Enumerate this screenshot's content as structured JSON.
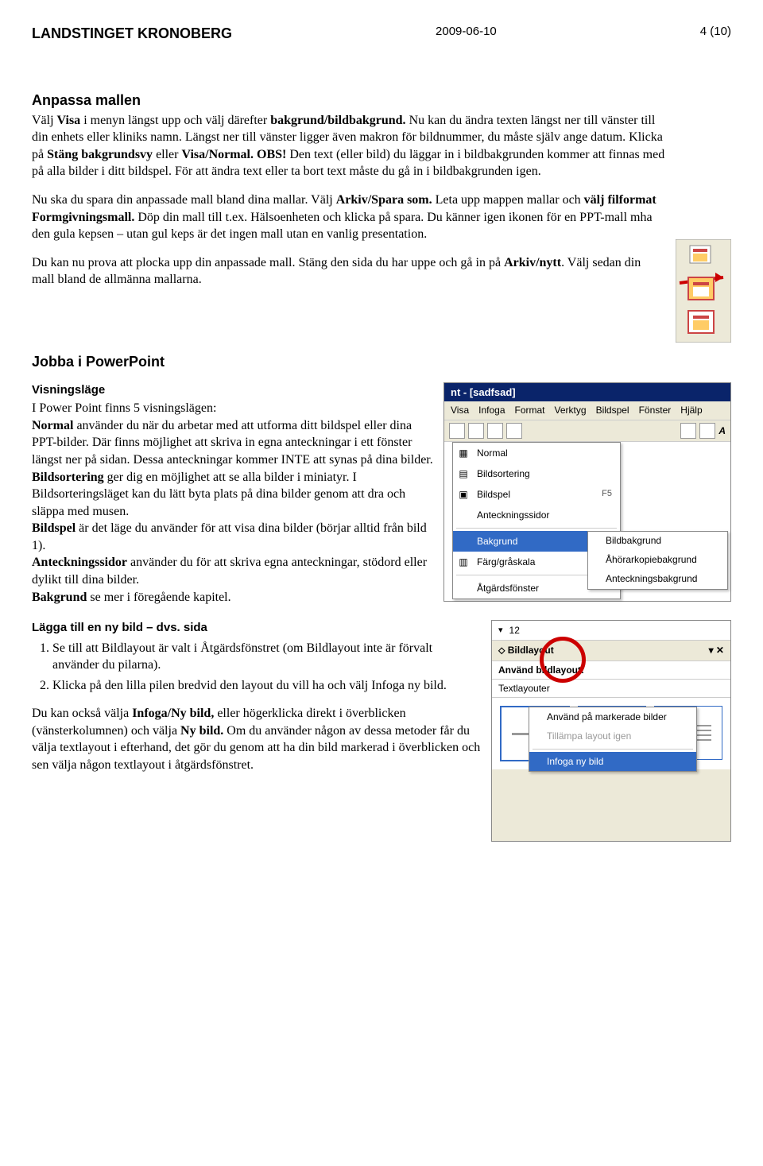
{
  "header": {
    "org": "LANDSTINGET KRONOBERG",
    "date": "2009-06-10",
    "page": "4 (10)"
  },
  "section1": {
    "title": "Anpassa mallen",
    "p1a": "Välj ",
    "p1b": "Visa",
    "p1c": " i menyn längst upp och välj därefter ",
    "p1d": "bakgrund/bildbakgrund.",
    "p1e": " Nu kan du ändra texten längst ner till vänster till din enhets eller kliniks namn. Längst ner till vänster ligger även makron för bildnummer, du måste själv ange datum. Klicka på ",
    "p1f": "Stäng bakgrundsvy",
    "p1g": " eller ",
    "p1h": "Visa/Normal.",
    "p1i": " ",
    "p1j": "OBS!",
    "p1k": " Den text (eller bild) du läggar in i bildbakgrunden kommer att finnas med på alla bilder i ditt bildspel. För att ändra text eller ta bort text måste du gå in i bildbakgrunden igen.",
    "p2a": "Nu ska du spara din anpassade mall bland dina mallar. Välj ",
    "p2b": "Arkiv/Spara som.",
    "p2c": " Leta upp mappen mallar och ",
    "p2d": "välj filformat Formgivningsmall.",
    "p2e": " Döp din mall till t.ex. Hälsoenheten och klicka på spara. Du känner igen ikonen för en PPT-mall mha den gula kepsen – utan gul keps är det ingen mall utan en vanlig presentation.",
    "p3a": "Du kan nu prova att plocka upp din anpassade mall. Stäng den sida du har uppe och gå in på ",
    "p3b": "Arkiv/nytt",
    "p3c": ". Välj sedan din mall bland de allmänna mallarna."
  },
  "section2": {
    "title": "Jobba i PowerPoint",
    "sub1": "Visningsläge",
    "p1a": "I Power Point finns 5 visningslägen:",
    "p1b": "Normal",
    "p1c": " använder du när du arbetar med att utforma ditt bildspel eller dina PPT-bilder. Där finns möjlighet att skriva in egna anteckningar i ett fönster längst ner på sidan. Dessa anteckningar kommer INTE att synas på dina bilder.",
    "p1d": "Bildsortering",
    "p1e": " ger dig en möjlighet att se alla bilder i miniatyr. I Bildsorteringsläget kan du lätt byta plats på dina bilder genom att dra och släppa med musen.",
    "p1f": "Bildspel",
    "p1g": " är det läge du använder för att visa dina bilder (börjar alltid från bild 1).",
    "p1h": "Anteckningssidor",
    "p1i": " använder du för att skriva egna anteckningar, stödord eller dylikt till dina bilder.",
    "p1j": "Bakgrund",
    "p1k": " se mer i föregående kapitel.",
    "sub2": "Lägga till en ny bild – dvs. sida",
    "li1": "Se till att Bildlayout är valt i Åtgärdsfönstret (om Bildlayout inte är förvalt använder du pilarna).",
    "li2": "Klicka på den lilla pilen bredvid den layout du vill ha och välj Infoga ny bild.",
    "p5a": "Du kan också välja ",
    "p5b": "Infoga/Ny bild,",
    "p5c": " eller högerklicka direkt i överblicken (vänsterkolumnen) och välja ",
    "p5d": "Ny bild.",
    "p5e": " Om du använder någon av dessa metoder får du välja textlayout i efterhand, det gör du genom att ha din bild markerad i överblicken och sen välja någon textlayout i åtgärdsfönstret."
  },
  "ppt": {
    "title": "nt - [sadfsad]",
    "menus": [
      "Visa",
      "Infoga",
      "Format",
      "Verktyg",
      "Bildspel",
      "Fönster",
      "Hjälp"
    ],
    "items": {
      "normal": "Normal",
      "bildsortering": "Bildsortering",
      "bildspel": "Bildspel",
      "f5": "F5",
      "anteckningssidor": "Anteckningssidor",
      "bakgrund": "Bakgrund",
      "farggraskala": "Färg/gråskala",
      "atgardsfonster": "Åtgärdsfönster"
    },
    "submenu": {
      "bildbakgrund": "Bildbakgrund",
      "ahorarkopie": "Åhörarkopiebakgrund",
      "antecknings": "Anteckningsbakgrund"
    }
  },
  "layoutpane": {
    "fontsize": "12",
    "title": "Bildlayout",
    "header": "Använd bildlayout:",
    "section": "Textlayouter",
    "ctx": {
      "apply": "Använd på markerade bilder",
      "reapply": "Tillämpa layout igen",
      "insert": "Infoga ny bild"
    }
  }
}
